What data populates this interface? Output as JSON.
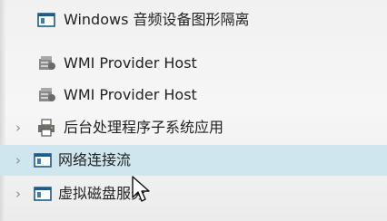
{
  "process_list": {
    "rows": [
      {
        "label": "Windows 音频设备图形隔离",
        "icon": "service-window-icon",
        "expandable": false,
        "selected": false
      },
      {
        "label": "WMI Provider Host",
        "icon": "wmi-host-icon",
        "expandable": false,
        "selected": false
      },
      {
        "label": "WMI Provider Host",
        "icon": "wmi-host-icon",
        "expandable": false,
        "selected": false
      },
      {
        "label": "后台处理程序子系统应用",
        "icon": "printer-icon",
        "expandable": true,
        "selected": false
      },
      {
        "label": "网络连接流",
        "icon": "service-window-icon",
        "expandable": true,
        "selected": true
      },
      {
        "label": "虚拟磁盘服务",
        "icon": "service-window-icon",
        "expandable": true,
        "selected": false
      }
    ]
  },
  "colors": {
    "selected_row": "#cfe6ee",
    "text": "#222222"
  }
}
